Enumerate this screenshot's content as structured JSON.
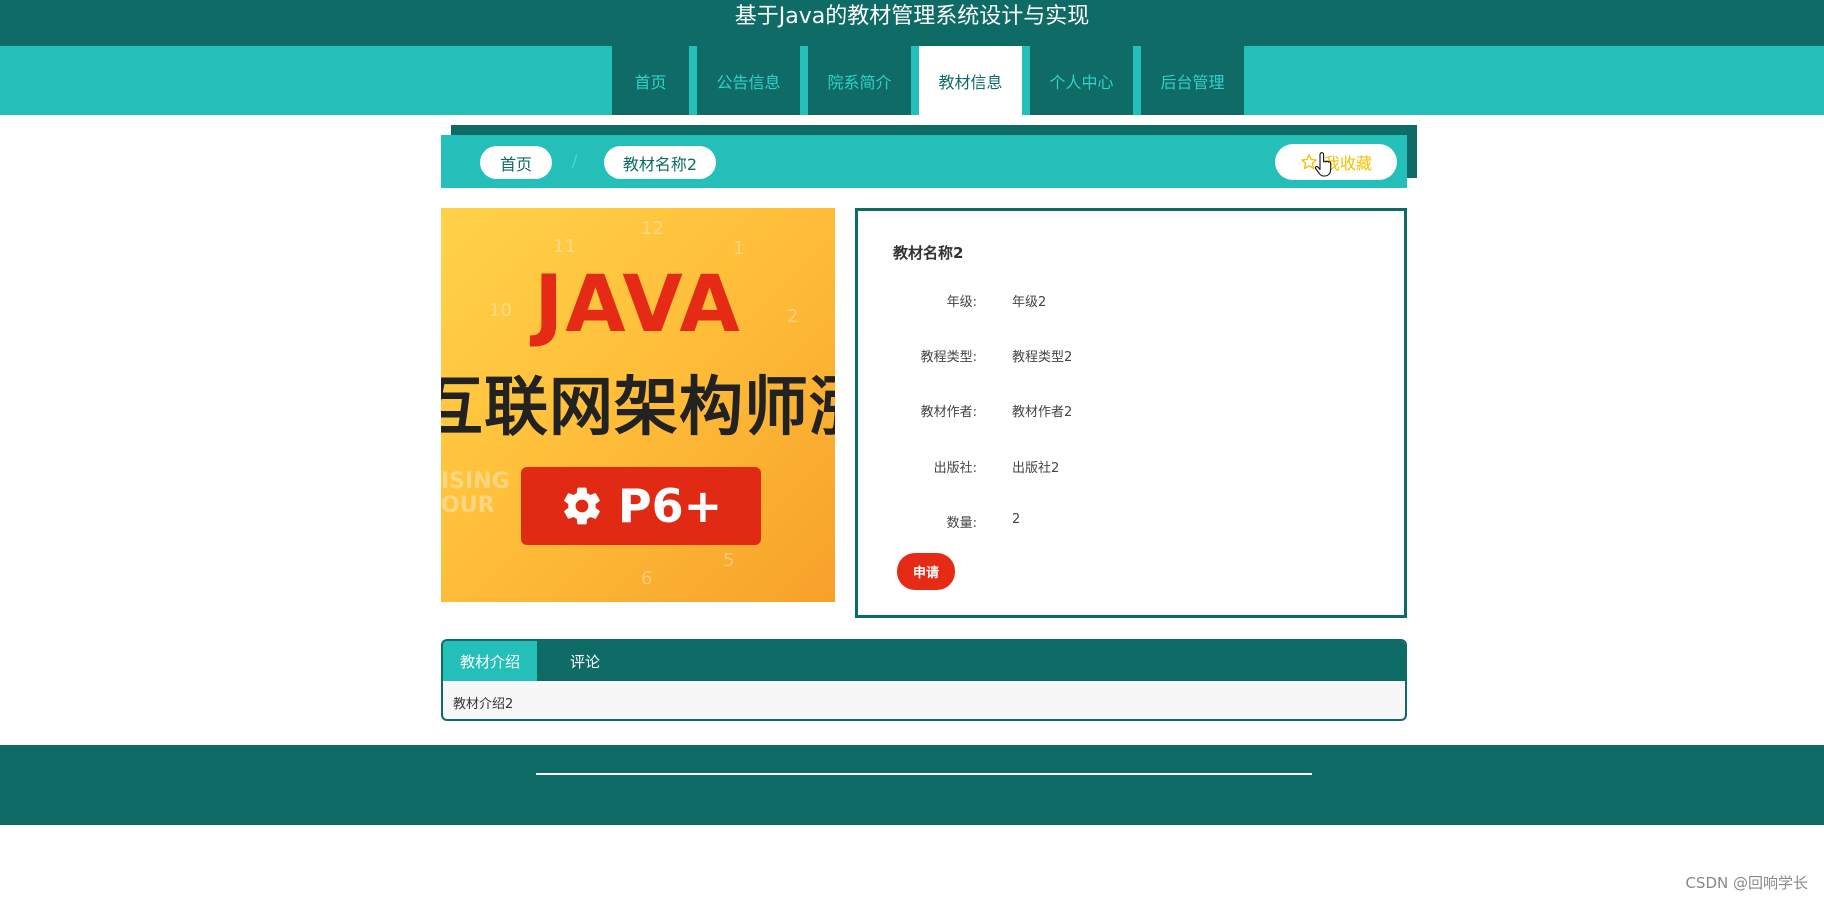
{
  "site": {
    "title": "基于Java的教材管理系统设计与实现"
  },
  "nav": {
    "items": [
      {
        "label": "首页"
      },
      {
        "label": "公告信息"
      },
      {
        "label": "院系简介"
      },
      {
        "label": "教材信息",
        "active": true
      },
      {
        "label": "个人中心"
      },
      {
        "label": "后台管理"
      }
    ]
  },
  "breadcrumb": {
    "home": "首页",
    "separator": "/",
    "current": "教材名称2"
  },
  "favorite": {
    "label": "我收藏",
    "icon": "star-outline-icon"
  },
  "cover": {
    "headline": "JAVA",
    "subtitle": "互联网架构师涨薪",
    "badge": "P6+",
    "side_text": "ISING\nOUR"
  },
  "detail": {
    "title": "教材名称2",
    "fields": [
      {
        "label": "年级:",
        "value": "年级2"
      },
      {
        "label": "教程类型:",
        "value": "教程类型2"
      },
      {
        "label": "教材作者:",
        "value": "教材作者2"
      },
      {
        "label": "出版社:",
        "value": "出版社2"
      },
      {
        "label": "数量:",
        "value": "2"
      }
    ],
    "apply_label": "申请"
  },
  "tabs": {
    "items": [
      {
        "label": "教材介绍",
        "active": true
      },
      {
        "label": "评论"
      }
    ],
    "content": "教材介绍2"
  },
  "watermark": "CSDN @回响学长",
  "colors": {
    "primary_dark": "#0f6b66",
    "primary": "#24bfb9",
    "accent_red": "#e52b16",
    "star": "#f2c200"
  }
}
